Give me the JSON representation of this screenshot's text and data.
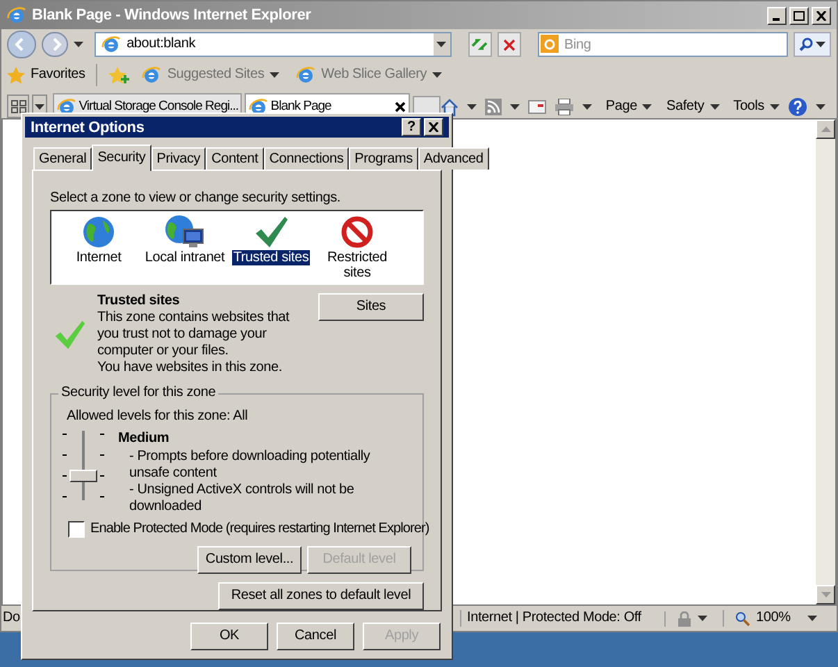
{
  "window": {
    "title": "Blank Page - Windows Internet Explorer"
  },
  "address": {
    "url": "about:blank"
  },
  "search": {
    "placeholder": "Bing"
  },
  "favorites_bar": {
    "favorites": "Favorites",
    "links": [
      "Suggested Sites",
      "Web Slice Gallery"
    ]
  },
  "tabs": [
    {
      "label": "Virtual Storage Console Regi...",
      "selected": false
    },
    {
      "label": "Blank Page",
      "selected": true
    }
  ],
  "command_bar": [
    "Page",
    "Safety",
    "Tools"
  ],
  "status_bar": {
    "text": "Do",
    "zone": "Internet | Protected Mode: Off",
    "zoom": "100%"
  },
  "dialog": {
    "title": "Internet Options",
    "help_button": "?",
    "tabs": [
      {
        "label": "General",
        "selected": false
      },
      {
        "label": "Security",
        "selected": true
      },
      {
        "label": "Privacy",
        "selected": false
      },
      {
        "label": "Content",
        "selected": false
      },
      {
        "label": "Connections",
        "selected": false
      },
      {
        "label": "Programs",
        "selected": false
      },
      {
        "label": "Advanced",
        "selected": false
      }
    ],
    "zone_prompt": "Select a zone to view or change security settings.",
    "zones": [
      {
        "kind": "internet",
        "label": "Internet",
        "selected": false
      },
      {
        "kind": "intranet",
        "label": "Local intranet",
        "selected": false
      },
      {
        "kind": "trusted",
        "label": "Trusted sites",
        "selected": true
      },
      {
        "kind": "restricted",
        "label": "Restricted sites",
        "selected": false
      }
    ],
    "zone_title": "Trusted sites",
    "zone_description": [
      "This zone contains websites that you trust not to damage your computer or your files.",
      "You have websites in this zone."
    ],
    "sites_button": "Sites",
    "level_group": "Security level for this zone",
    "allowed": "Allowed levels for this zone: All",
    "level_name": "Medium",
    "level_points": [
      "- Prompts before downloading potentially unsafe content",
      "- Unsigned ActiveX controls will not be downloaded"
    ],
    "slider": {
      "level": 0.333
    },
    "protected_mode": {
      "label": "Enable Protected Mode (requires restarting Internet Explorer)",
      "checked": false
    },
    "level_buttons": [
      {
        "label": "Custom level...",
        "disabled": false
      },
      {
        "label": "Default level",
        "disabled": true
      }
    ],
    "reset_button": "Reset all zones to default level",
    "footer_buttons": [
      {
        "label": "OK",
        "disabled": false
      },
      {
        "label": "Cancel",
        "disabled": false
      },
      {
        "label": "Apply",
        "disabled": true
      }
    ]
  }
}
